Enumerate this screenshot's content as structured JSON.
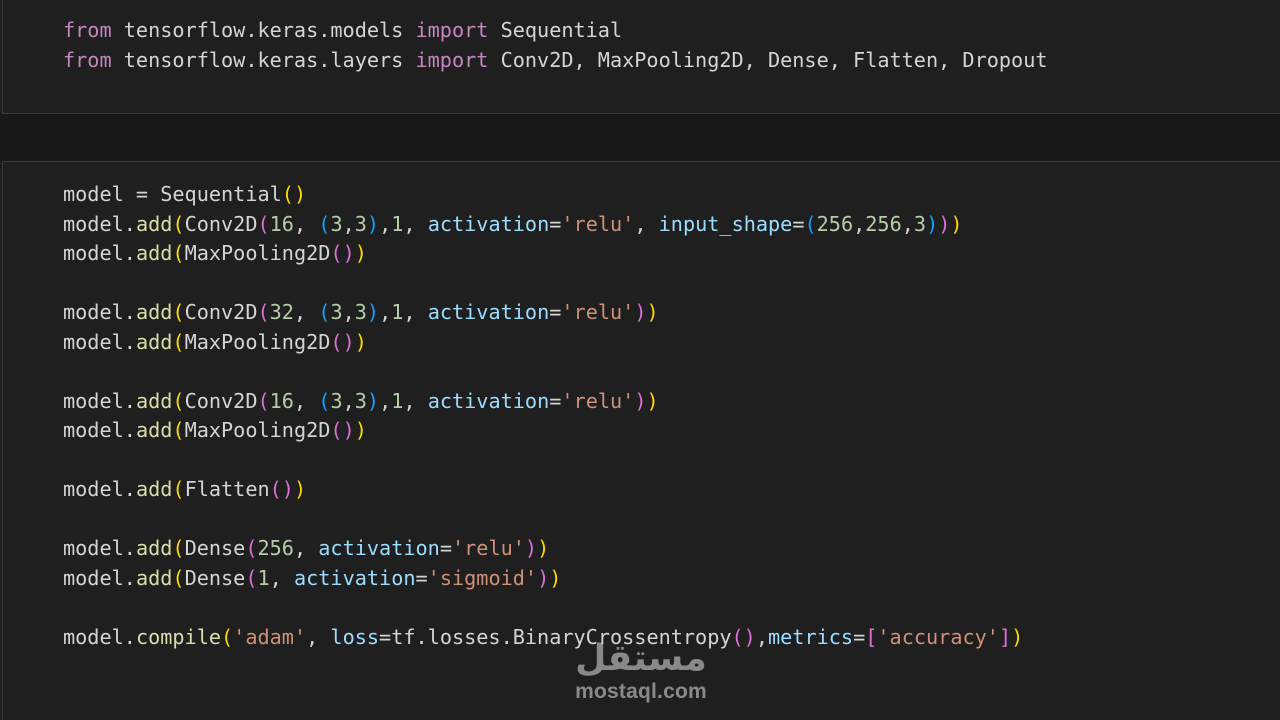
{
  "cell1": {
    "lines": [
      [
        {
          "t": "from",
          "c": "kw"
        },
        {
          "t": " tensorflow.keras.models ",
          "c": "nm"
        },
        {
          "t": "import",
          "c": "kw"
        },
        {
          "t": " Sequential",
          "c": "cls"
        }
      ],
      [
        {
          "t": "from",
          "c": "kw"
        },
        {
          "t": " tensorflow.keras.layers ",
          "c": "nm"
        },
        {
          "t": "import",
          "c": "kw"
        },
        {
          "t": " Conv2D, MaxPooling2D, Dense, Flatten, Dropout",
          "c": "cls"
        }
      ]
    ]
  },
  "cell2": {
    "lines": [
      [
        {
          "t": "model",
          "c": "nm"
        },
        {
          "t": " = ",
          "c": "op"
        },
        {
          "t": "Sequential",
          "c": "cls"
        },
        {
          "t": "()",
          "c": "b1"
        }
      ],
      [
        {
          "t": "model.",
          "c": "nm"
        },
        {
          "t": "add",
          "c": "fn"
        },
        {
          "t": "(",
          "c": "b1"
        },
        {
          "t": "Conv2D",
          "c": "cls"
        },
        {
          "t": "(",
          "c": "b2"
        },
        {
          "t": "16",
          "c": "num"
        },
        {
          "t": ", ",
          "c": "op"
        },
        {
          "t": "(",
          "c": "b3"
        },
        {
          "t": "3",
          "c": "num"
        },
        {
          "t": ",",
          "c": "op"
        },
        {
          "t": "3",
          "c": "num"
        },
        {
          "t": ")",
          "c": "b3"
        },
        {
          "t": ",",
          "c": "op"
        },
        {
          "t": "1",
          "c": "num"
        },
        {
          "t": ", ",
          "c": "op"
        },
        {
          "t": "activation",
          "c": "par"
        },
        {
          "t": "=",
          "c": "op"
        },
        {
          "t": "'relu'",
          "c": "str"
        },
        {
          "t": ", ",
          "c": "op"
        },
        {
          "t": "input_shape",
          "c": "par"
        },
        {
          "t": "=",
          "c": "op"
        },
        {
          "t": "(",
          "c": "b3"
        },
        {
          "t": "256",
          "c": "num"
        },
        {
          "t": ",",
          "c": "op"
        },
        {
          "t": "256",
          "c": "num"
        },
        {
          "t": ",",
          "c": "op"
        },
        {
          "t": "3",
          "c": "num"
        },
        {
          "t": ")",
          "c": "b3"
        },
        {
          "t": ")",
          "c": "b2"
        },
        {
          "t": ")",
          "c": "b1"
        }
      ],
      [
        {
          "t": "model.",
          "c": "nm"
        },
        {
          "t": "add",
          "c": "fn"
        },
        {
          "t": "(",
          "c": "b1"
        },
        {
          "t": "MaxPooling2D",
          "c": "cls"
        },
        {
          "t": "()",
          "c": "b2"
        },
        {
          "t": ")",
          "c": "b1"
        }
      ],
      [],
      [
        {
          "t": "model.",
          "c": "nm"
        },
        {
          "t": "add",
          "c": "fn"
        },
        {
          "t": "(",
          "c": "b1"
        },
        {
          "t": "Conv2D",
          "c": "cls"
        },
        {
          "t": "(",
          "c": "b2"
        },
        {
          "t": "32",
          "c": "num"
        },
        {
          "t": ", ",
          "c": "op"
        },
        {
          "t": "(",
          "c": "b3"
        },
        {
          "t": "3",
          "c": "num"
        },
        {
          "t": ",",
          "c": "op"
        },
        {
          "t": "3",
          "c": "num"
        },
        {
          "t": ")",
          "c": "b3"
        },
        {
          "t": ",",
          "c": "op"
        },
        {
          "t": "1",
          "c": "num"
        },
        {
          "t": ", ",
          "c": "op"
        },
        {
          "t": "activation",
          "c": "par"
        },
        {
          "t": "=",
          "c": "op"
        },
        {
          "t": "'relu'",
          "c": "str"
        },
        {
          "t": ")",
          "c": "b2"
        },
        {
          "t": ")",
          "c": "b1"
        }
      ],
      [
        {
          "t": "model.",
          "c": "nm"
        },
        {
          "t": "add",
          "c": "fn"
        },
        {
          "t": "(",
          "c": "b1"
        },
        {
          "t": "MaxPooling2D",
          "c": "cls"
        },
        {
          "t": "()",
          "c": "b2"
        },
        {
          "t": ")",
          "c": "b1"
        }
      ],
      [],
      [
        {
          "t": "model.",
          "c": "nm"
        },
        {
          "t": "add",
          "c": "fn"
        },
        {
          "t": "(",
          "c": "b1"
        },
        {
          "t": "Conv2D",
          "c": "cls"
        },
        {
          "t": "(",
          "c": "b2"
        },
        {
          "t": "16",
          "c": "num"
        },
        {
          "t": ", ",
          "c": "op"
        },
        {
          "t": "(",
          "c": "b3"
        },
        {
          "t": "3",
          "c": "num"
        },
        {
          "t": ",",
          "c": "op"
        },
        {
          "t": "3",
          "c": "num"
        },
        {
          "t": ")",
          "c": "b3"
        },
        {
          "t": ",",
          "c": "op"
        },
        {
          "t": "1",
          "c": "num"
        },
        {
          "t": ", ",
          "c": "op"
        },
        {
          "t": "activation",
          "c": "par"
        },
        {
          "t": "=",
          "c": "op"
        },
        {
          "t": "'relu'",
          "c": "str"
        },
        {
          "t": ")",
          "c": "b2"
        },
        {
          "t": ")",
          "c": "b1"
        }
      ],
      [
        {
          "t": "model.",
          "c": "nm"
        },
        {
          "t": "add",
          "c": "fn"
        },
        {
          "t": "(",
          "c": "b1"
        },
        {
          "t": "MaxPooling2D",
          "c": "cls"
        },
        {
          "t": "()",
          "c": "b2"
        },
        {
          "t": ")",
          "c": "b1"
        }
      ],
      [],
      [
        {
          "t": "model.",
          "c": "nm"
        },
        {
          "t": "add",
          "c": "fn"
        },
        {
          "t": "(",
          "c": "b1"
        },
        {
          "t": "Flatten",
          "c": "cls"
        },
        {
          "t": "()",
          "c": "b2"
        },
        {
          "t": ")",
          "c": "b1"
        }
      ],
      [],
      [
        {
          "t": "model.",
          "c": "nm"
        },
        {
          "t": "add",
          "c": "fn"
        },
        {
          "t": "(",
          "c": "b1"
        },
        {
          "t": "Dense",
          "c": "cls"
        },
        {
          "t": "(",
          "c": "b2"
        },
        {
          "t": "256",
          "c": "num"
        },
        {
          "t": ", ",
          "c": "op"
        },
        {
          "t": "activation",
          "c": "par"
        },
        {
          "t": "=",
          "c": "op"
        },
        {
          "t": "'relu'",
          "c": "str"
        },
        {
          "t": ")",
          "c": "b2"
        },
        {
          "t": ")",
          "c": "b1"
        }
      ],
      [
        {
          "t": "model.",
          "c": "nm"
        },
        {
          "t": "add",
          "c": "fn"
        },
        {
          "t": "(",
          "c": "b1"
        },
        {
          "t": "Dense",
          "c": "cls"
        },
        {
          "t": "(",
          "c": "b2"
        },
        {
          "t": "1",
          "c": "num"
        },
        {
          "t": ", ",
          "c": "op"
        },
        {
          "t": "activation",
          "c": "par"
        },
        {
          "t": "=",
          "c": "op"
        },
        {
          "t": "'sigmoid'",
          "c": "str"
        },
        {
          "t": ")",
          "c": "b2"
        },
        {
          "t": ")",
          "c": "b1"
        }
      ],
      [],
      [
        {
          "t": "model.",
          "c": "nm"
        },
        {
          "t": "compile",
          "c": "fn"
        },
        {
          "t": "(",
          "c": "b1"
        },
        {
          "t": "'adam'",
          "c": "str"
        },
        {
          "t": ", ",
          "c": "op"
        },
        {
          "t": "loss",
          "c": "par"
        },
        {
          "t": "=",
          "c": "op"
        },
        {
          "t": "tf.losses.",
          "c": "nm"
        },
        {
          "t": "BinaryCrossentropy",
          "c": "cls"
        },
        {
          "t": "()",
          "c": "b2"
        },
        {
          "t": ",",
          "c": "op"
        },
        {
          "t": "metrics",
          "c": "par"
        },
        {
          "t": "=",
          "c": "op"
        },
        {
          "t": "[",
          "c": "b2"
        },
        {
          "t": "'accuracy'",
          "c": "str"
        },
        {
          "t": "]",
          "c": "b2"
        },
        {
          "t": ")",
          "c": "b1"
        }
      ]
    ]
  },
  "watermark": {
    "logo_text": "مستقل",
    "domain": "mostaql.com"
  }
}
